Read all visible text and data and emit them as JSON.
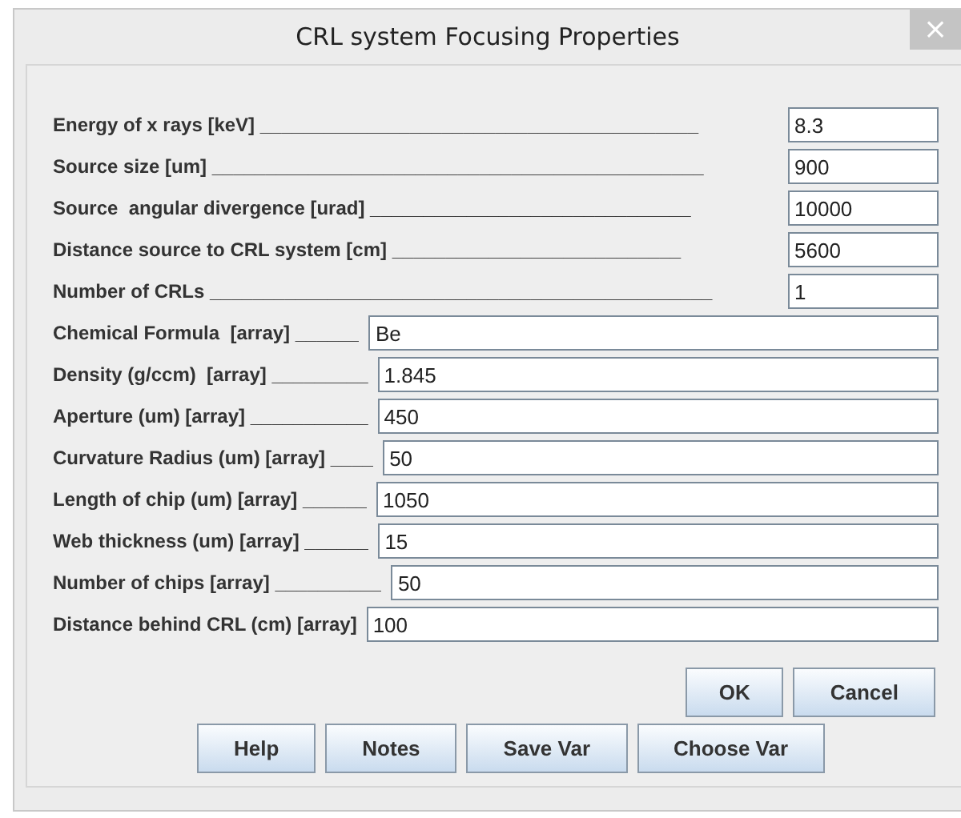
{
  "window": {
    "title": "CRL system Focusing Properties",
    "close": "×"
  },
  "fields": [
    {
      "label": "Energy of x rays [keV] _________________________________________",
      "value": "8.3",
      "kind": "short"
    },
    {
      "label": "Source size [um] ______________________________________________",
      "value": "900",
      "kind": "short"
    },
    {
      "label": "Source  angular divergence [urad] ______________________________",
      "value": "10000",
      "kind": "short"
    },
    {
      "label": "Distance source to CRL system [cm] ___________________________",
      "value": "5600",
      "kind": "short"
    },
    {
      "label": "Number of CRLs _______________________________________________",
      "value": "1",
      "kind": "short"
    },
    {
      "label": "Chemical Formula  [array] ______",
      "value": "Be",
      "kind": "wide"
    },
    {
      "label": "Density (g/ccm)  [array] _________",
      "value": "1.845",
      "kind": "wide"
    },
    {
      "label": "Aperture (um) [array] ___________",
      "value": "450",
      "kind": "wide"
    },
    {
      "label": "Curvature Radius (um) [array] ____",
      "value": "50",
      "kind": "wide"
    },
    {
      "label": "Length of chip (um) [array] ______",
      "value": "1050",
      "kind": "wide"
    },
    {
      "label": "Web thickness (um) [array] ______",
      "value": "15",
      "kind": "wide"
    },
    {
      "label": "Number of chips [array] __________",
      "value": "50",
      "kind": "wide"
    },
    {
      "label": "Distance behind CRL (cm) [array]",
      "value": "100",
      "kind": "wide"
    }
  ],
  "dialog_buttons": [
    "OK",
    "Cancel"
  ],
  "tool_buttons": [
    "Help",
    "Notes",
    "Save Var",
    "Choose Var"
  ]
}
